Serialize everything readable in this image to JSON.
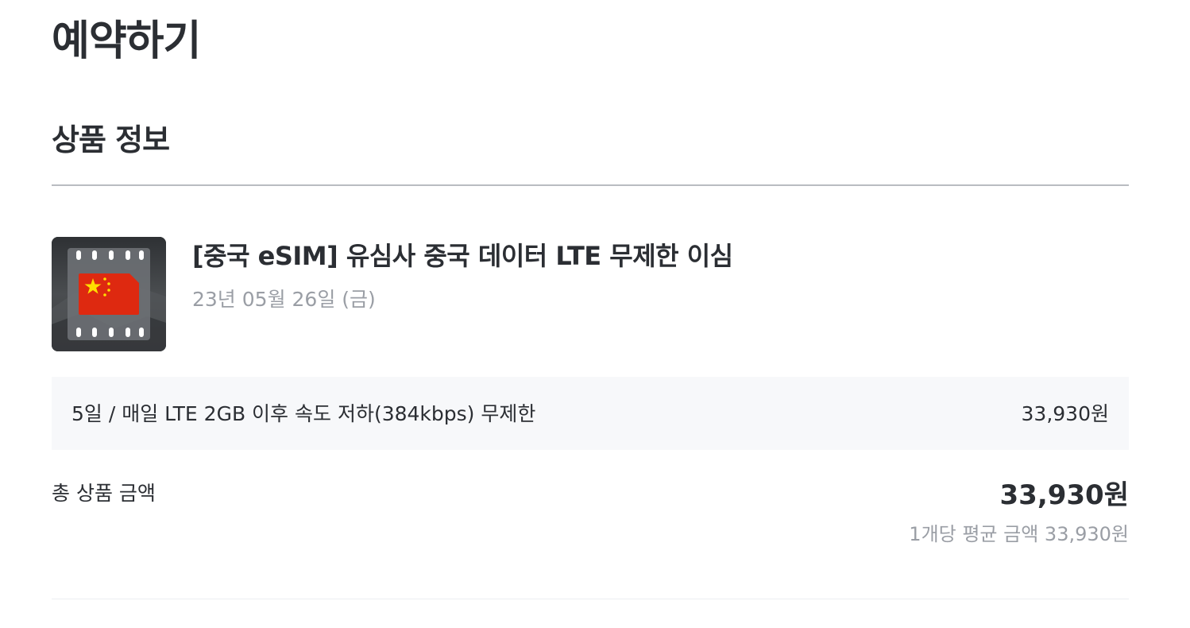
{
  "page": {
    "title": "예약하기"
  },
  "product_section": {
    "title": "상품 정보",
    "thumbnail": {
      "icon": "china-esim-card-icon",
      "flag_color": "#de2910",
      "star_color": "#ffde00"
    },
    "product": {
      "name": "[중국 eSIM] 유심사 중국 데이터 LTE 무제한 이심",
      "date": "23년 05월 26일 (금)"
    },
    "option": {
      "label": "5일 / 매일 LTE 2GB 이후 속도 저하(384kbps) 무제한",
      "price": "33,930원"
    },
    "total": {
      "label": "총 상품 금액",
      "amount": "33,930원",
      "average": "1개당 평균 금액 33,930원"
    }
  },
  "colors": {
    "text_primary": "#2b2e33",
    "text_secondary": "#9a9ea5",
    "option_background": "#f7f8fa",
    "divider": "#b9bcc1"
  }
}
